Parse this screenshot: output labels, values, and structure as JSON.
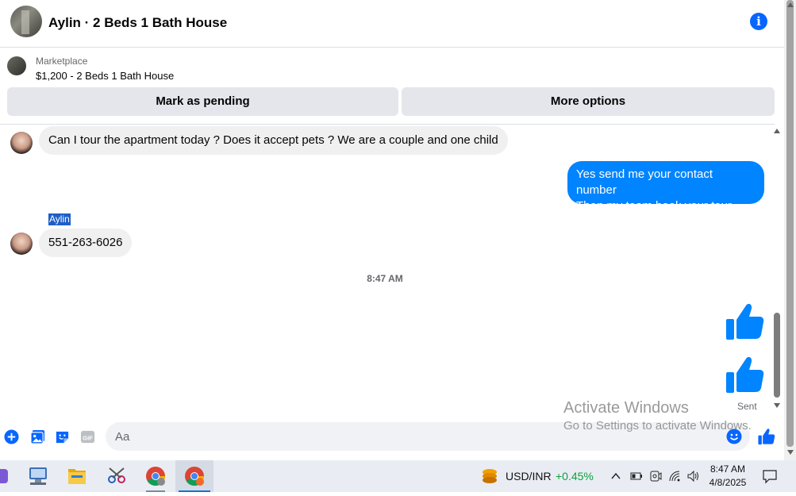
{
  "header": {
    "title": "Aylin · 2 Beds 1 Bath House",
    "info_icon": "info-icon"
  },
  "marketplace": {
    "label": "Marketplace",
    "item": "$1,200 - 2 Beds 1 Bath House",
    "buttons": {
      "pending": "Mark as pending",
      "more": "More options"
    }
  },
  "messages": [
    {
      "direction": "incoming",
      "text": "Can I tour the apartment today ? Does it accept pets ? We are a couple and one child"
    },
    {
      "direction": "outgoing",
      "lines": [
        "Yes send me your contact number",
        "Then my team book your tour"
      ]
    },
    {
      "direction": "incoming",
      "sender": "Aylin",
      "text": "551-263-6026"
    }
  ],
  "timestamp": "8:47 AM",
  "reactions": [
    "thumbs-up-icon",
    "thumbs-up-icon"
  ],
  "status": "Sent",
  "composer": {
    "placeholder": "Aa",
    "tools": [
      "plus-icon",
      "photo-icon",
      "sticker-icon",
      "gif-icon"
    ],
    "emoji_icon": "smiley-icon",
    "send_icon": "thumbs-up-icon"
  },
  "watermark": {
    "line1": "Activate Windows",
    "line2": "Go to Settings to activate Windows."
  },
  "taskbar": {
    "apps": [
      "teams-icon",
      "network-app-icon",
      "file-explorer-icon",
      "snipping-tool-icon",
      "chrome-icon",
      "chrome-profile-icon"
    ],
    "ticker": {
      "symbol": "USD/INR",
      "change": "+0.45%"
    },
    "time": "8:47 AM",
    "date": "4/8/2025"
  },
  "colors": {
    "messenger_blue": "#0084ff",
    "accent_blue": "#0866ff",
    "ticker_green": "#0e9f3e"
  }
}
